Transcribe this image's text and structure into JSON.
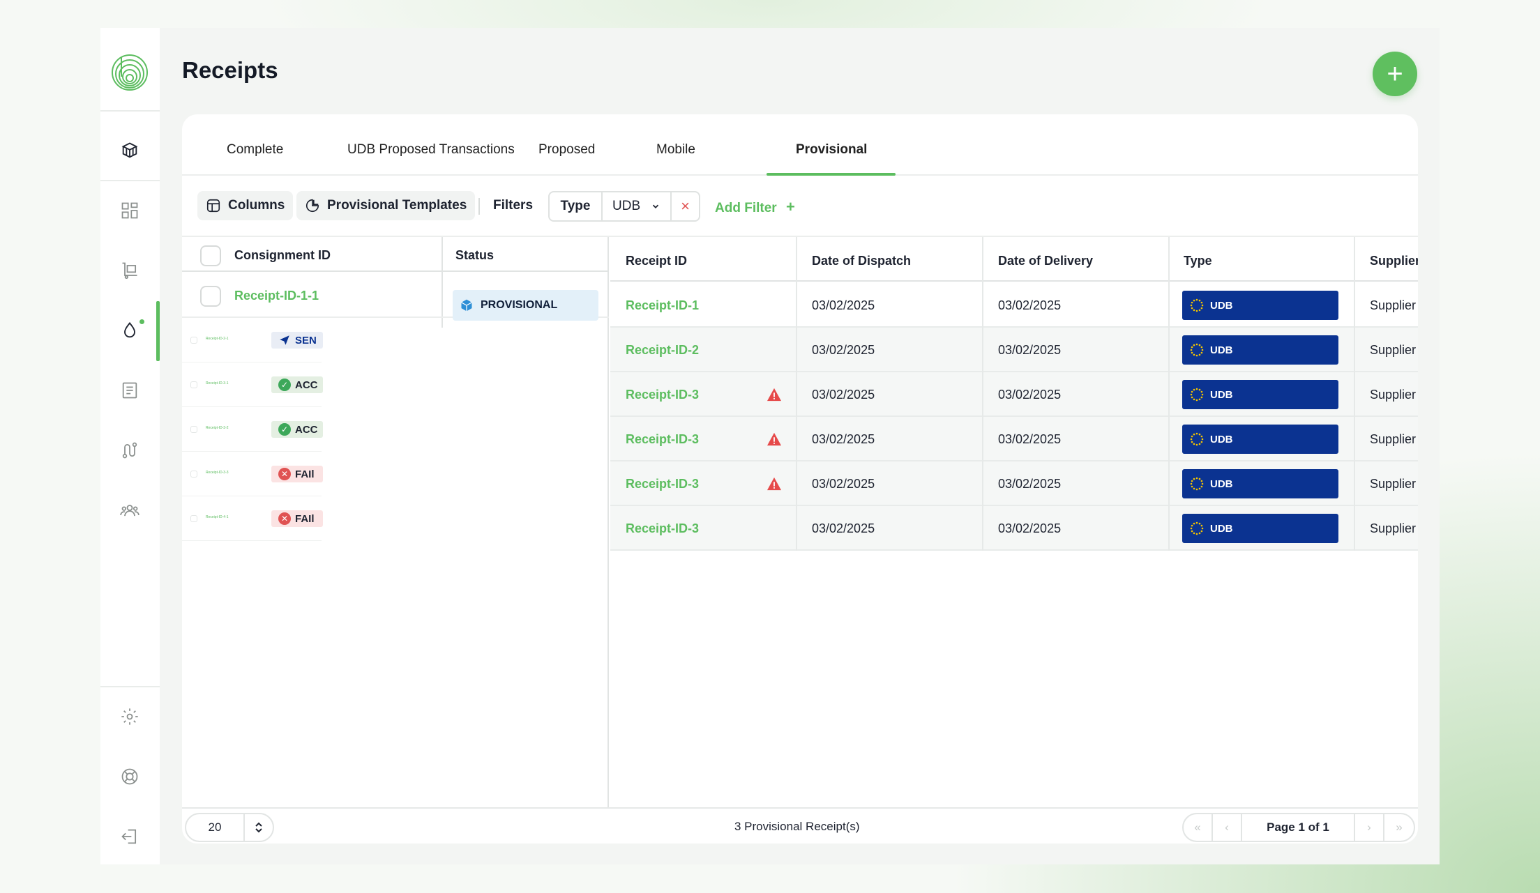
{
  "page": {
    "title": "Receipts",
    "new_button": "+"
  },
  "tabs": [
    {
      "label": "Complete"
    },
    {
      "label": "UDB Proposed Transactions"
    },
    {
      "label": "Proposed"
    },
    {
      "label": "Mobile"
    },
    {
      "label": "Provisional",
      "active": true
    }
  ],
  "toolbar": {
    "columns_label": "Columns",
    "templates_label": "Provisional Templates",
    "filters_label": "Filters",
    "filter_chip": {
      "field": "Type",
      "value": "UDB",
      "remove": "×"
    },
    "add_filter_label": "Add Filter",
    "add_filter_icon": "+"
  },
  "left_table": {
    "headers": {
      "id": "Consignment ID",
      "status": "Status"
    },
    "main_row": {
      "id": "Receipt-ID-1-1",
      "status": "PROVISIONAL"
    },
    "mini_rows": [
      {
        "id": "Receipt-ID-2-1",
        "status": "SEN",
        "status_color": "#0b3391",
        "icon": "send-icon",
        "bg": "#e9edf5"
      },
      {
        "id": "Receipt-ID-3-1",
        "status": "ACC",
        "status_color": "#1e2330",
        "icon": "check-icon",
        "bg": "#e4efe2"
      },
      {
        "id": "Receipt-ID-3-2",
        "status": "ACC",
        "status_color": "#1e2330",
        "icon": "check-icon",
        "bg": "#e4efe2"
      },
      {
        "id": "Receipt-ID-3-3",
        "status": "FAIl",
        "status_color": "#1e2330",
        "icon": "x-icon",
        "bg": "#fbe3e3"
      },
      {
        "id": "Receipt-ID-4-1",
        "status": "FAIl",
        "status_color": "#1e2330",
        "icon": "x-icon",
        "bg": "#fbe3e3"
      }
    ]
  },
  "right_table": {
    "headers": {
      "receipt_id": "Receipt ID",
      "dispatch": "Date of Dispatch",
      "delivery": "Date of Delivery",
      "type": "Type",
      "supplier": "Supplier"
    },
    "rows": [
      {
        "receipt_id": "Receipt-ID-1",
        "warning": false,
        "dispatch": "03/02/2025",
        "delivery": "03/02/2025",
        "type": "UDB",
        "supplier": "Supplier"
      },
      {
        "receipt_id": "Receipt-ID-2",
        "warning": false,
        "dispatch": "03/02/2025",
        "delivery": "03/02/2025",
        "type": "UDB",
        "supplier": "Supplier"
      },
      {
        "receipt_id": "Receipt-ID-3",
        "warning": true,
        "dispatch": "03/02/2025",
        "delivery": "03/02/2025",
        "type": "UDB",
        "supplier": "Supplier"
      },
      {
        "receipt_id": "Receipt-ID-3",
        "warning": true,
        "dispatch": "03/02/2025",
        "delivery": "03/02/2025",
        "type": "UDB",
        "supplier": "Supplier"
      },
      {
        "receipt_id": "Receipt-ID-3",
        "warning": true,
        "dispatch": "03/02/2025",
        "delivery": "03/02/2025",
        "type": "UDB",
        "supplier": "Supplier"
      },
      {
        "receipt_id": "Receipt-ID-3",
        "warning": false,
        "dispatch": "03/02/2025",
        "delivery": "03/02/2025",
        "type": "UDB",
        "supplier": "Supplier"
      }
    ]
  },
  "footer": {
    "page_size": "20",
    "count_text": "3 Provisional Receipt(s)",
    "page_text": "Page 1 of 1",
    "first": "«",
    "prev": "‹",
    "next": "›",
    "last": "»"
  },
  "colors": {
    "accent": "#5cbd5f",
    "udb_badge": "#0b3391",
    "warning": "#e64a4a",
    "provisional_bg": "#e3f0f9"
  }
}
